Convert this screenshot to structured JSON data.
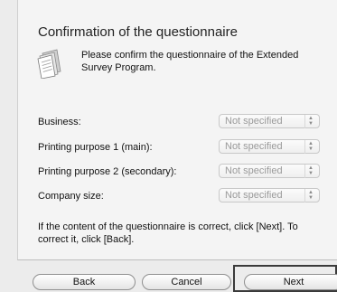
{
  "dialog": {
    "title": "Confirmation of the questionnaire",
    "intro": "Please confirm the questionnaire of the Extended Survey Program.",
    "icon": "document-stack-icon"
  },
  "fields": [
    {
      "label": "Business:",
      "value": "Not specified"
    },
    {
      "label": "Printing purpose 1 (main):",
      "value": "Not specified"
    },
    {
      "label": "Printing purpose 2 (secondary):",
      "value": "Not specified"
    },
    {
      "label": "Company size:",
      "value": "Not specified"
    }
  ],
  "note": "If the content of the questionnaire is correct, click [Next]. To correct it, click [Back].",
  "buttons": {
    "back": "Back",
    "cancel": "Cancel",
    "next": "Next"
  },
  "colors": {
    "background": "#ececec",
    "panel": "#f4f4f4",
    "disabled_text": "#9a9a9a"
  }
}
